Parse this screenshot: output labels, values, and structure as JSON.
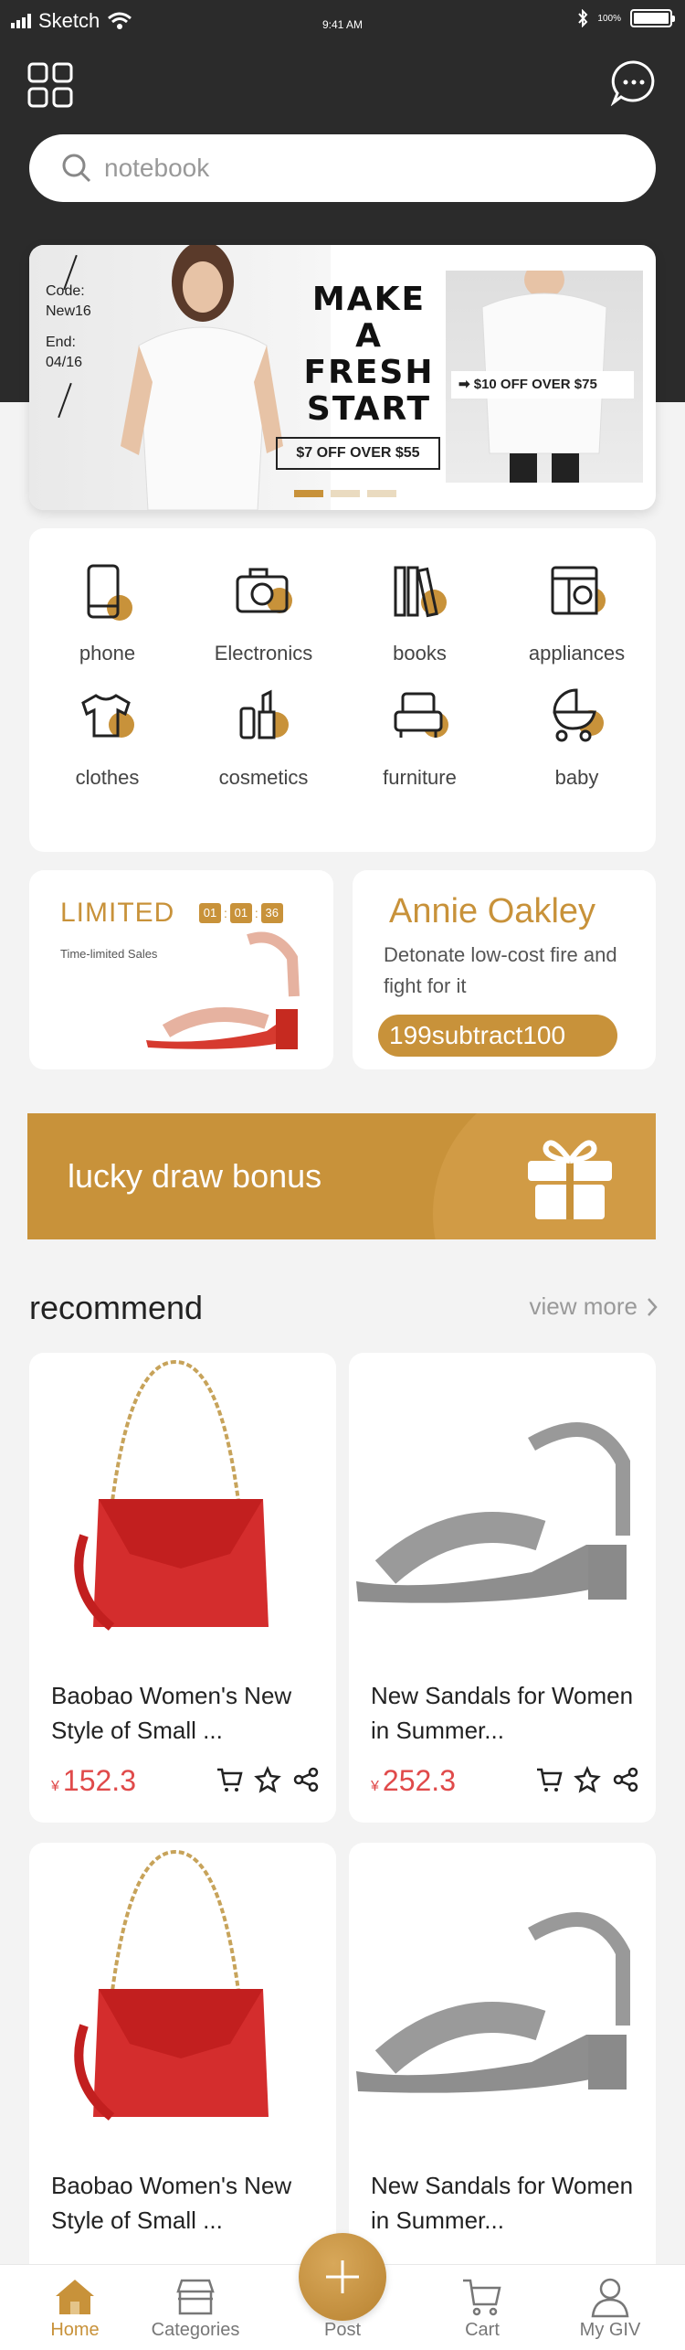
{
  "status_bar": {
    "carrier": "Sketch",
    "time": "9:41 AM",
    "battery": "100%"
  },
  "search": {
    "placeholder": "notebook"
  },
  "banner": {
    "code_label": "Code:",
    "code_value": "New16",
    "end_label": "End:",
    "end_value": "04/16",
    "headline_lines": [
      "MAKE",
      "A",
      "FRESH",
      "START"
    ],
    "promo_left": "$7 OFF OVER $55",
    "promo_right": "➡ $10 OFF OVER $75"
  },
  "categories": [
    {
      "label": "phone",
      "icon": "phone-icon"
    },
    {
      "label": "Electronics",
      "icon": "camera-icon"
    },
    {
      "label": "books",
      "icon": "books-icon"
    },
    {
      "label": "appliances",
      "icon": "washing-machine-icon"
    },
    {
      "label": "clothes",
      "icon": "tshirt-icon"
    },
    {
      "label": "cosmetics",
      "icon": "cosmetics-icon"
    },
    {
      "label": "furniture",
      "icon": "armchair-icon"
    },
    {
      "label": "baby",
      "icon": "stroller-icon"
    }
  ],
  "limited": {
    "title": "LIMITED",
    "countdown": [
      "01",
      "01",
      "36"
    ],
    "subtitle": "Time-limited Sales"
  },
  "annie": {
    "name": "Annie Oakley",
    "desc": "Detonate low-cost fire and fight for it",
    "pill": "199subtract100"
  },
  "lucky": {
    "label": "lucky draw bonus"
  },
  "recommend": {
    "title": "recommend",
    "view_more": "view more"
  },
  "products": [
    {
      "name": "Baobao Women's New Style of Small ...",
      "currency": "¥",
      "price": "152.3",
      "image": "red-handbag"
    },
    {
      "name": "New Sandals for Women in Summer...",
      "currency": "¥",
      "price": "252.3",
      "image": "grey-sandal"
    },
    {
      "name": "Baobao Women's New Style of Small ...",
      "currency": "¥",
      "price": "",
      "image": "red-handbag"
    },
    {
      "name": "New Sandals for Women in Summer...",
      "currency": "¥",
      "price": "",
      "image": "grey-sandal"
    }
  ],
  "tabs": [
    {
      "label": "Home",
      "icon": "home-icon",
      "active": true
    },
    {
      "label": "Categories",
      "icon": "shop-icon",
      "active": false
    },
    {
      "label": "Post",
      "icon": "plus-icon",
      "active": false
    },
    {
      "label": "Cart",
      "icon": "cart-icon",
      "active": false
    },
    {
      "label": "My GIV",
      "icon": "user-icon",
      "active": false
    }
  ],
  "colors": {
    "accent": "#c8923a",
    "dark": "#2b2b2b",
    "price": "#e04a4a"
  }
}
